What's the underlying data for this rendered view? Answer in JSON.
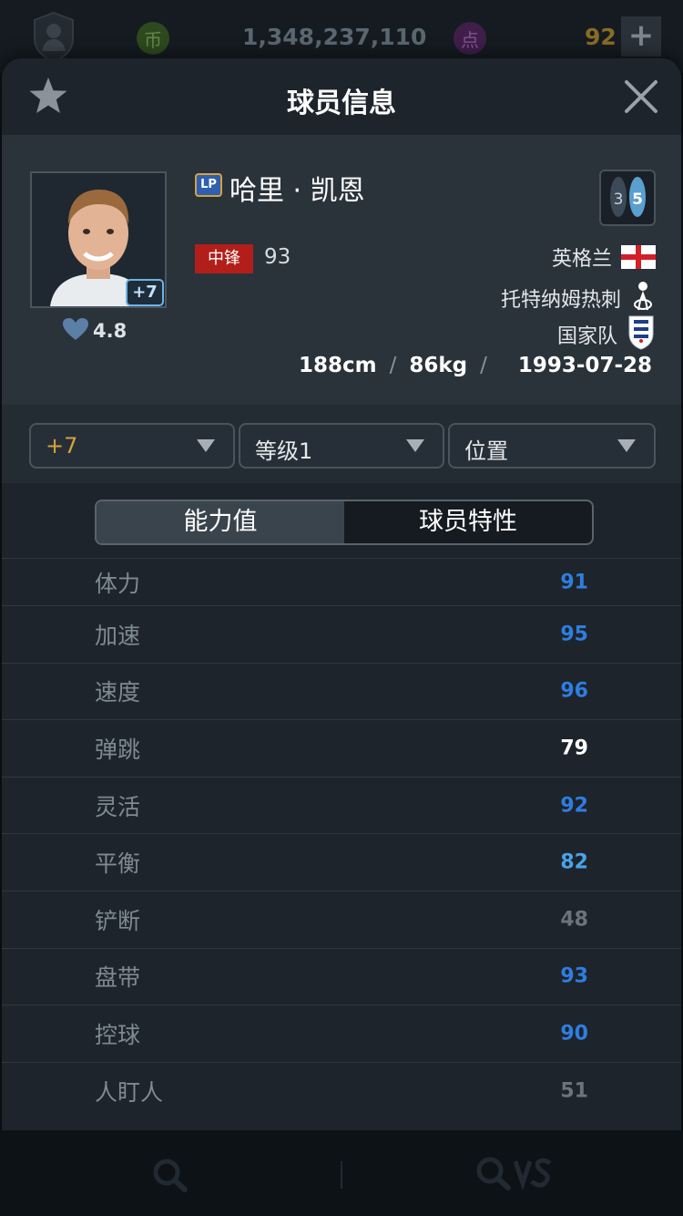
{
  "topbar": {
    "coins": "1,348,237,110",
    "coin_icon": "币",
    "points": "92",
    "point_icon": "点",
    "plus": "+"
  },
  "modal": {
    "title": "球员信息"
  },
  "player": {
    "lp_badge": "LP",
    "name": "哈里 · 凯恩",
    "upgrade": "+7",
    "rating": "4.8",
    "boots_left": "3",
    "boots_right": "5",
    "position": "中锋",
    "position_ovr": "93",
    "nation": "英格兰",
    "club": "托特纳姆热刺",
    "national_team": "国家队",
    "height": "188cm",
    "weight": "86kg",
    "birthdate": "1993-07-28"
  },
  "filters": {
    "upgrade_level": "+7",
    "grade": "等级1",
    "position": "位置"
  },
  "tabs": [
    {
      "label": "能力值"
    },
    {
      "label": "球员特性"
    }
  ],
  "stats": [
    {
      "name": "体力",
      "value": "91",
      "color": "#2f7de0"
    },
    {
      "name": "加速",
      "value": "95",
      "color": "#2f7de0"
    },
    {
      "name": "速度",
      "value": "96",
      "color": "#2f7de0"
    },
    {
      "name": "弹跳",
      "value": "79",
      "color": "#ffffff"
    },
    {
      "name": "灵活",
      "value": "92",
      "color": "#2f7de0"
    },
    {
      "name": "平衡",
      "value": "82",
      "color": "#4aa3e6"
    },
    {
      "name": "铲断",
      "value": "48",
      "color": "#6b747c"
    },
    {
      "name": "盘带",
      "value": "93",
      "color": "#2f7de0"
    },
    {
      "name": "控球",
      "value": "90",
      "color": "#2f7de0"
    },
    {
      "name": "人盯人",
      "value": "51",
      "color": "#6b747c"
    }
  ],
  "colors": {
    "accent_gold": "#d6a23a",
    "position_red": "#b21f1a"
  }
}
